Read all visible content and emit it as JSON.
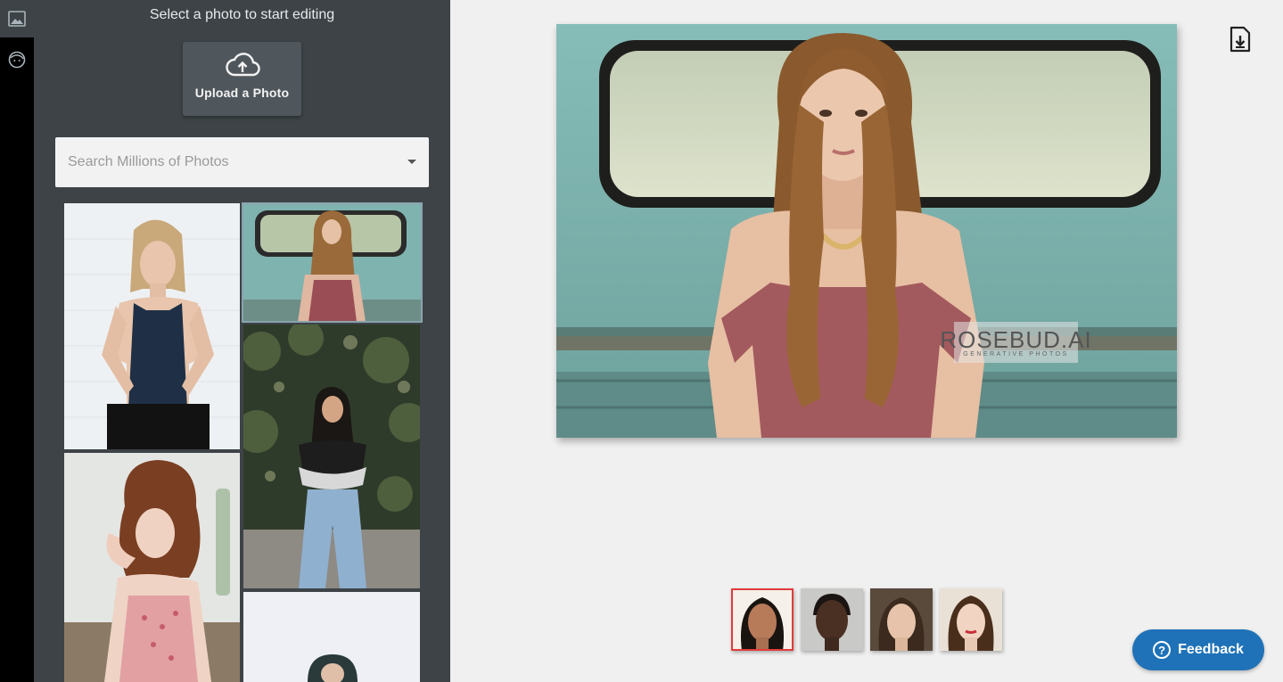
{
  "sidebar": {
    "title": "Select a photo to start editing",
    "upload_label": "Upload a Photo",
    "search_placeholder": "Search Millions of Photos",
    "rail_icons": [
      "image-icon",
      "face-icon"
    ]
  },
  "watermark": {
    "title": "ROSEBUD.AI",
    "subtitle": "GENERATIVE PHOTOS"
  },
  "feedback": {
    "label": "Feedback",
    "icon": "?"
  },
  "colors": {
    "panel_bg": "#3d4347",
    "rail_bg": "#000000",
    "main_bg": "#f0f0f0",
    "feedback_bg": "#1f72b7",
    "face_selected": "#e23b3b"
  }
}
